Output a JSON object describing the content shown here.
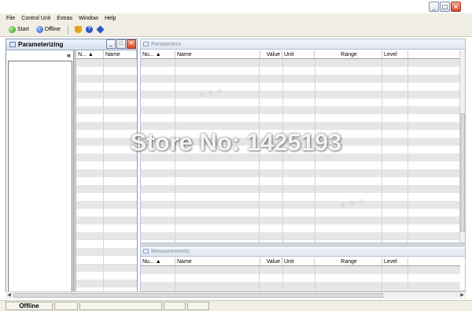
{
  "menu": [
    "File",
    "Control Unit",
    "Extras",
    "Window",
    "Help"
  ],
  "toolbar": {
    "start_label": "Start",
    "offline_label": "Offline"
  },
  "left_panel": {
    "title": "Parameterizing",
    "collapse_glyph": "«",
    "columns": [
      "N... ▲",
      "Name"
    ]
  },
  "parameters": {
    "title": "Parameters",
    "columns": [
      "Nu... ▲",
      "Name",
      "Value",
      "Unit",
      "Range",
      "Level"
    ]
  },
  "measurements": {
    "title": "Measurements",
    "columns": [
      "Nu... ▲",
      "Name",
      "Value",
      "Unit",
      "Range",
      "Level"
    ]
  },
  "status": {
    "mode": "Offline"
  },
  "watermark": "Store No: 1425193"
}
